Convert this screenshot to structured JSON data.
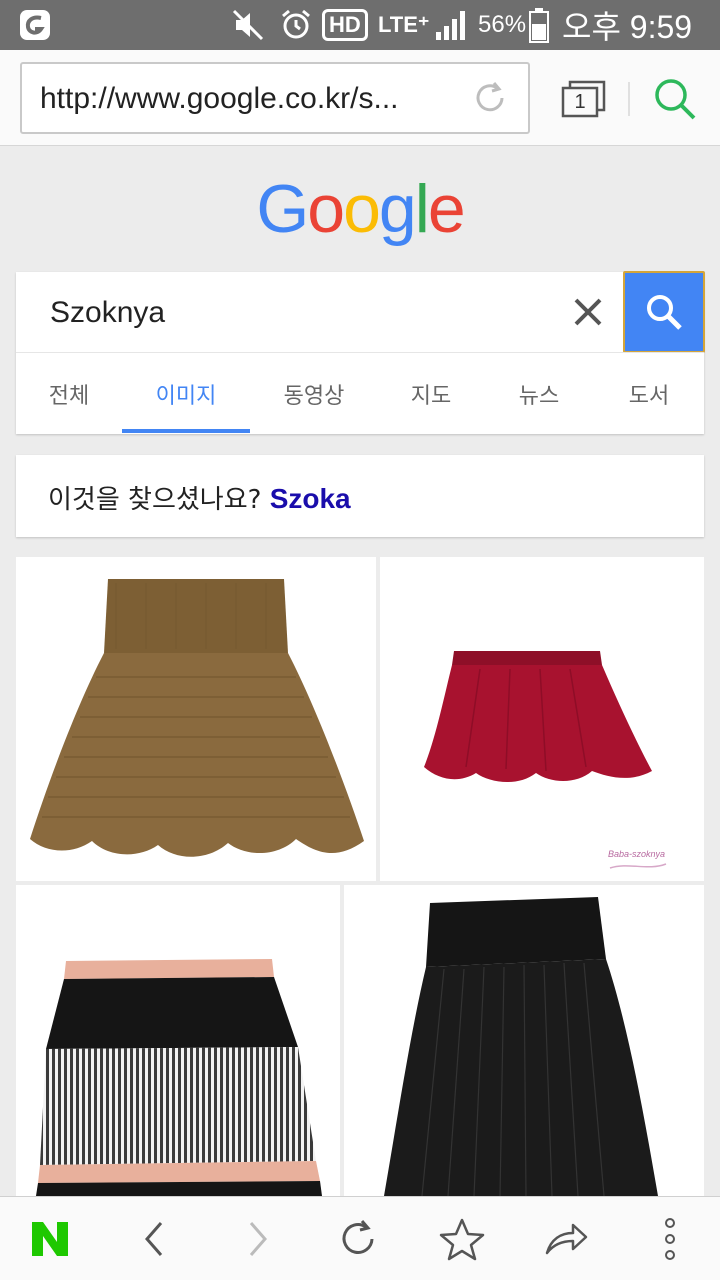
{
  "status_bar": {
    "battery": "56%",
    "time": "오후 9:59",
    "network": "LTE⁺",
    "hd_label": "HD"
  },
  "browser": {
    "url": "http://www.google.co.kr/s...",
    "tab_count": "1"
  },
  "search": {
    "logo": [
      "G",
      "o",
      "o",
      "g",
      "l",
      "e"
    ],
    "logo_colors": [
      "#4285f4",
      "#ea4335",
      "#fbbc05",
      "#4285f4",
      "#34a853",
      "#ea4335"
    ],
    "query": "Szoknya",
    "tabs": [
      "전체",
      "이미지",
      "동영상",
      "지도",
      "뉴스",
      "도서"
    ],
    "active_tab": "이미지",
    "accent": "#4285f4"
  },
  "did_you_mean": {
    "prompt": "이것을 찾으셨나요?",
    "suggestion": "Szoka"
  },
  "image_results": [
    {
      "name": "brown-knit-flared-skirt"
    },
    {
      "name": "red-chiffon-skirt",
      "watermark": "Baba-szoknya"
    },
    {
      "name": "black-striped-pink-trim-skirt"
    },
    {
      "name": "black-pleated-skirt"
    }
  ],
  "bottom_bar": {
    "icons": [
      "naver-n-icon",
      "back-icon",
      "forward-icon",
      "reload-icon",
      "bookmark-star-icon",
      "share-icon",
      "more-icon"
    ]
  }
}
